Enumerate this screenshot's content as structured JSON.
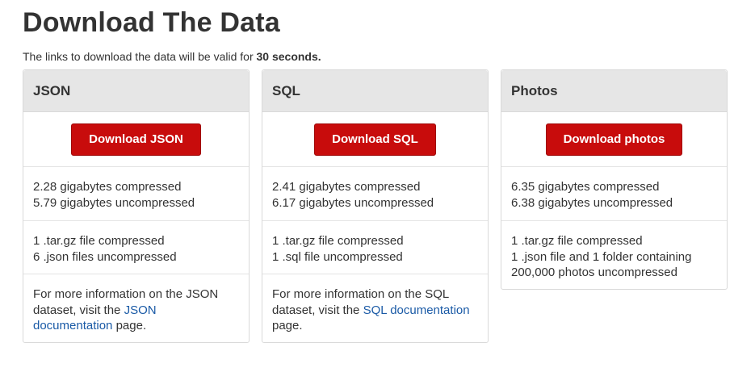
{
  "page": {
    "title": "Download The Data",
    "intro_prefix": "The links to download the data will be valid for ",
    "intro_bold": "30 seconds."
  },
  "cards": [
    {
      "heading": "JSON",
      "button": "Download JSON",
      "size_lines": [
        "2.28 gigabytes compressed",
        "5.79 gigabytes uncompressed"
      ],
      "file_lines": [
        "1 .tar.gz file compressed",
        "6 .json files uncompressed"
      ],
      "info_prefix": "For more information on the JSON dataset, visit the ",
      "info_link": "JSON documentation",
      "info_suffix": " page."
    },
    {
      "heading": "SQL",
      "button": "Download SQL",
      "size_lines": [
        "2.41 gigabytes compressed",
        "6.17 gigabytes uncompressed"
      ],
      "file_lines": [
        "1 .tar.gz file compressed",
        "1 .sql file uncompressed"
      ],
      "info_prefix": "For more information on the SQL dataset, visit the ",
      "info_link": "SQL documentation",
      "info_suffix": " page."
    },
    {
      "heading": "Photos",
      "button": "Download photos",
      "size_lines": [
        "6.35 gigabytes compressed",
        "6.38 gigabytes uncompressed"
      ],
      "file_lines": [
        "1 .tar.gz file compressed",
        "1 .json file and 1 folder containing",
        "200,000 photos uncompressed"
      ]
    }
  ],
  "colors": {
    "button": "#c80c0c",
    "link": "#1a5aa6",
    "card_header": "#e6e6e6"
  }
}
